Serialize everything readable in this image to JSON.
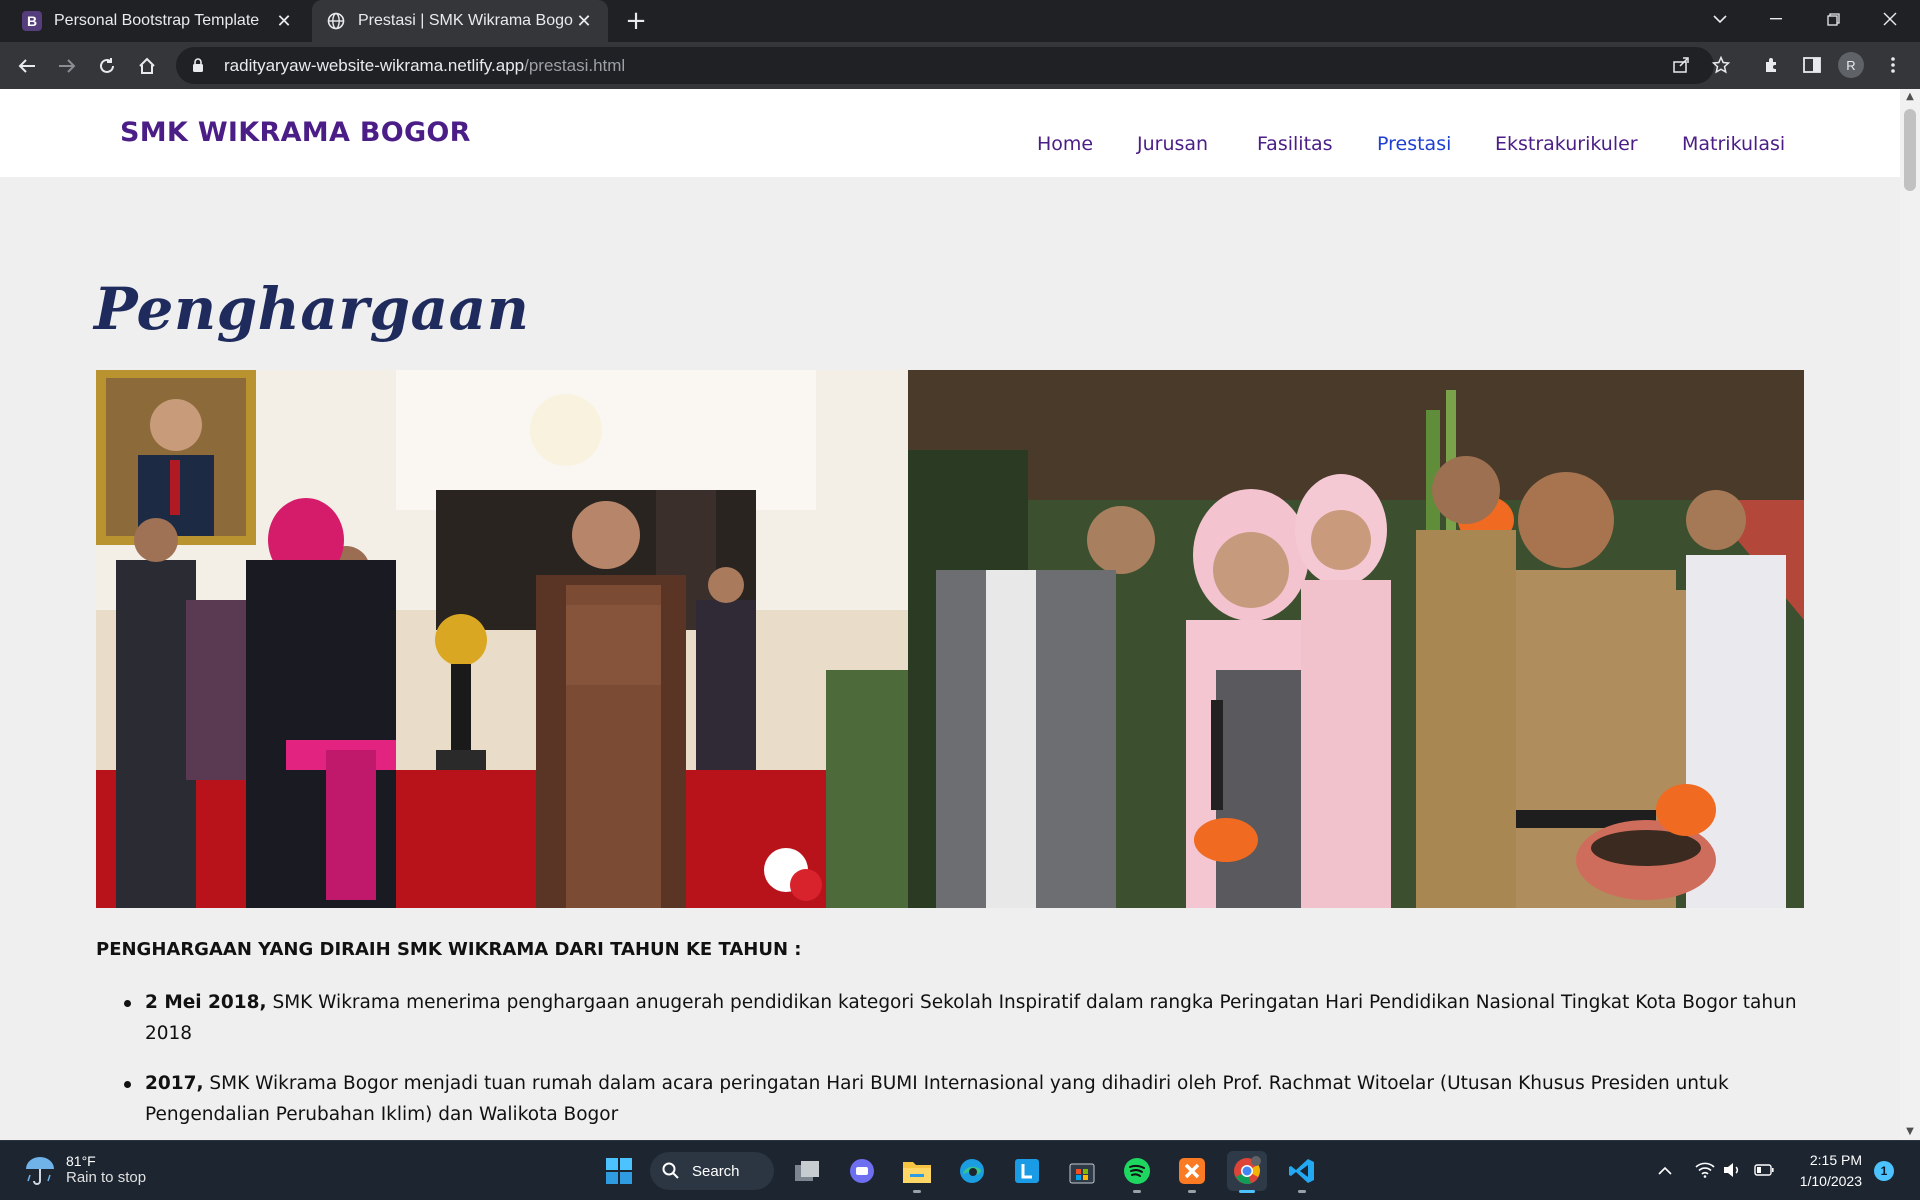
{
  "browser": {
    "tabs": [
      {
        "title": "Personal Bootstrap Template",
        "favicon": "bootstrap-icon",
        "active": false
      },
      {
        "title": "Prestasi | SMK Wikrama Bogor",
        "favicon": "globe-icon",
        "active": true
      }
    ],
    "new_tab_label": "+",
    "url_host": "radityaryaw-website-wikrama.netlify.app",
    "url_path": "/prestasi.html",
    "profile_initial": "R"
  },
  "site": {
    "brand": "SMK WIKRAMA BOGOR",
    "nav": [
      {
        "label": "Home",
        "active": false
      },
      {
        "label": "Jurusan",
        "active": false
      },
      {
        "label": "Fasilitas",
        "active": false
      },
      {
        "label": "Prestasi",
        "active": true
      },
      {
        "label": "Ekstrakurikuler",
        "active": false
      },
      {
        "label": "Matrikulasi",
        "active": false
      }
    ],
    "colors": {
      "brand": "#4b1d87",
      "nav_active": "#1e3fd1",
      "heading": "#1f2b5c",
      "page_bg": "#efefef"
    }
  },
  "content": {
    "heading": "Penghargaan",
    "lead": "PENGHARGAAN YANG DIRAIH SMK WIKRAMA DARI TAHUN KE TAHUN :",
    "awards": [
      {
        "date": "2 Mei 2018,",
        "text": " SMK Wikrama menerima penghargaan anugerah pendidikan kategori Sekolah Inspiratif dalam rangka Peringatan Hari Pendidikan Nasional Tingkat Kota Bogor tahun 2018"
      },
      {
        "date": "2017,",
        "text": " SMK Wikrama Bogor menjadi tuan rumah dalam acara peringatan Hari BUMI Internasional yang dihadiri oleh Prof. Rachmat Witoelar (Utusan Khusus Presiden untuk Pengendalian Perubahan Iklim) dan Walikota Bogor"
      }
    ]
  },
  "taskbar": {
    "weather_temp": "81°F",
    "weather_desc": "Rain to stop",
    "search_label": "Search",
    "time": "2:15 PM",
    "date": "1/10/2023",
    "notification_count": "1",
    "apps": [
      "start-icon",
      "task-view-icon",
      "teams-chat-icon",
      "file-explorer-icon",
      "edge-icon",
      "l-app-icon",
      "store-icon",
      "spotify-icon",
      "xampp-icon",
      "chrome-icon",
      "vscode-icon"
    ]
  }
}
